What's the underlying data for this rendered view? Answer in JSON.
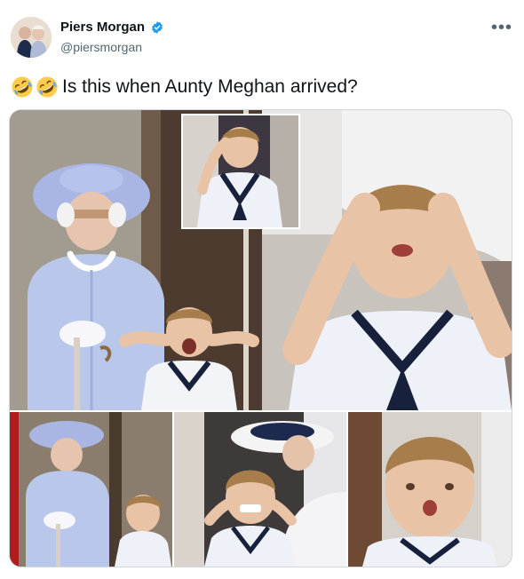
{
  "tweet": {
    "author": {
      "display_name": "Piers Morgan",
      "handle": "@piersmorgan",
      "verified": true,
      "avatar_icon": "profile-photo"
    },
    "more_icon": "more-options-icon",
    "text": "Is this when Aunty Meghan arrived?",
    "emojis": [
      "rolling-on-floor-laughing",
      "rolling-on-floor-laughing"
    ],
    "media": {
      "image_count": 6
    }
  },
  "colors": {
    "text_primary": "#0f1419",
    "text_secondary": "#536471",
    "verified_blue": "#1d9bf0",
    "border": "#cfd9de",
    "outfit_lilac": "#b8c7ea",
    "sailor_white": "#f3f4f8",
    "navy": "#17213b"
  }
}
